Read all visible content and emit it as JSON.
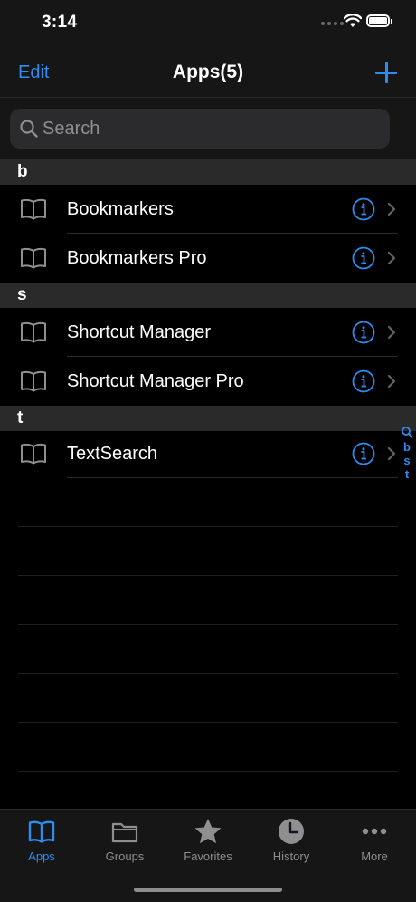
{
  "status": {
    "time": "3:14"
  },
  "nav": {
    "edit_label": "Edit",
    "title": "Apps(5)"
  },
  "search": {
    "placeholder": "Search"
  },
  "sections": [
    {
      "header": "b",
      "items": [
        "Bookmarkers",
        "Bookmarkers Pro"
      ]
    },
    {
      "header": "s",
      "items": [
        "Shortcut Manager",
        "Shortcut Manager Pro"
      ]
    },
    {
      "header": "t",
      "items": [
        "TextSearch"
      ]
    }
  ],
  "index": [
    "b",
    "s",
    "t"
  ],
  "tabs": [
    {
      "label": "Apps",
      "icon": "book-icon",
      "active": true
    },
    {
      "label": "Groups",
      "icon": "folder-icon",
      "active": false
    },
    {
      "label": "Favorites",
      "icon": "star-icon",
      "active": false
    },
    {
      "label": "History",
      "icon": "clock-icon",
      "active": false
    },
    {
      "label": "More",
      "icon": "ellipsis-icon",
      "active": false
    }
  ],
  "colors": {
    "accent": "#2e8cf0",
    "background": "#000000",
    "bar": "#161616",
    "section": "#2a2a2a"
  }
}
